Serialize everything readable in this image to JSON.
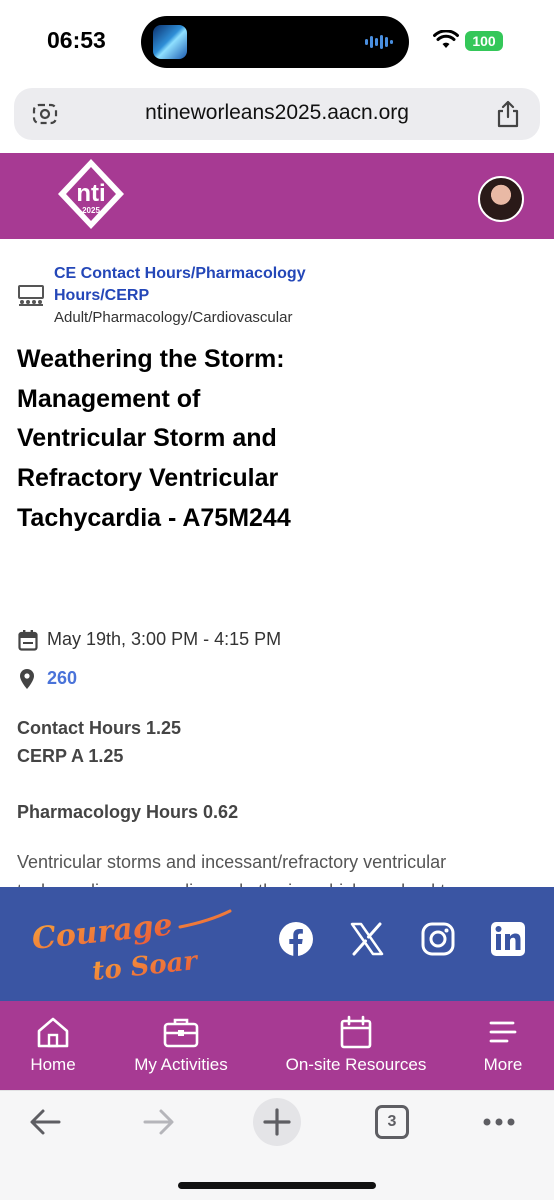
{
  "status_bar": {
    "time": "06:53",
    "battery": "100"
  },
  "browser": {
    "url": "ntineworleans2025.aacn.org",
    "tab_count": "3"
  },
  "site_header": {
    "logo_text": "nti",
    "logo_year": "2025"
  },
  "session": {
    "category_link": "CE Contact Hours/Pharmacology Hours/CERP",
    "category_sub": "Adult/Pharmacology/Cardiovascular",
    "title": "Weathering the Storm: Management of Ventricular Storm and Refractory Ventricular Tachycardia - A75M244",
    "date_time": "May 19th, 3:00 PM - 4:15 PM",
    "location": "260",
    "contact_hours": "Contact Hours 1.25",
    "cerp": "CERP A 1.25",
    "pharmacology_hours": "Pharmacology Hours 0.62",
    "description": "Ventricular storms and incessant/refractory ventricular tachycardias are cardiac arrhythmias which can lead to"
  },
  "footer": {
    "tagline_line1": "Courage",
    "tagline_line2": "to Soar",
    "social_icons": [
      "facebook-icon",
      "x-icon",
      "instagram-icon",
      "linkedin-icon"
    ]
  },
  "bottom_nav": {
    "items": [
      {
        "label": "Home",
        "icon": "home-icon"
      },
      {
        "label": "My Activities",
        "icon": "briefcase-icon"
      },
      {
        "label": "On-site Resources",
        "icon": "calendar-icon"
      },
      {
        "label": "More",
        "icon": "menu-icon"
      }
    ]
  },
  "colors": {
    "brand_magenta": "#a73a93",
    "footer_blue": "#3a55a3",
    "link_blue": "#2447b8"
  }
}
